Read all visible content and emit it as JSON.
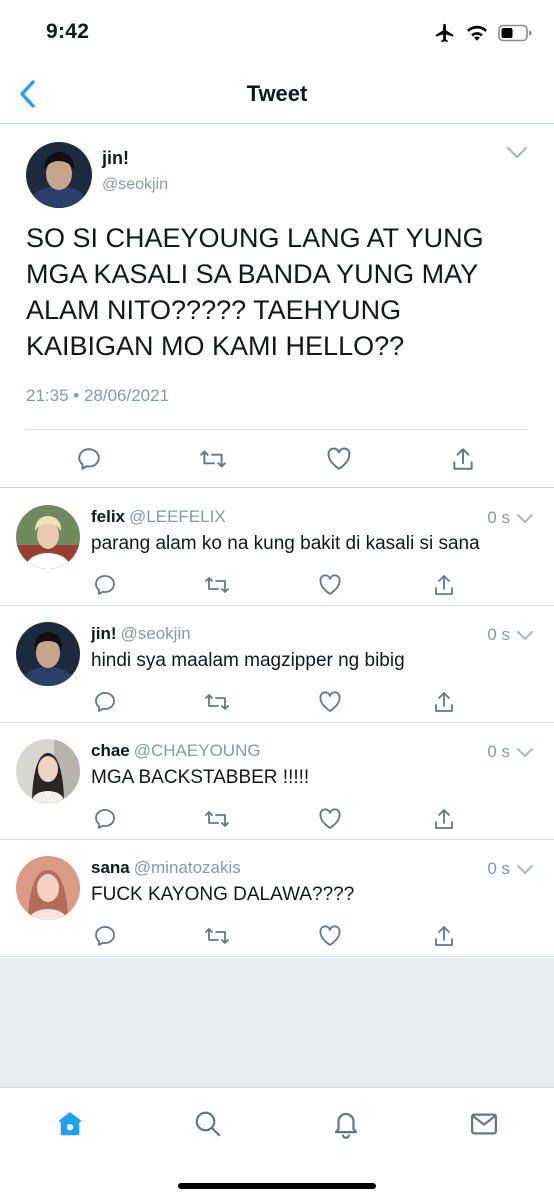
{
  "status_bar": {
    "time": "9:42"
  },
  "nav": {
    "title": "Tweet"
  },
  "main_tweet": {
    "name": "jin!",
    "handle": "@seokjin",
    "text": "SO SI CHAEYOUNG LANG AT YUNG MGA KASALI SA BANDA YUNG MAY ALAM NITO????? TAEHYUNG KAIBIGAN MO KAMI HELLO??",
    "timestamp": "21:35 • 28/06/2021"
  },
  "replies": [
    {
      "name": "felix",
      "handle": "@LEEFELIX",
      "time": "0 s",
      "text": "parang alam ko na kung bakit di kasali si sana"
    },
    {
      "name": "jin!",
      "handle": "@seokjin",
      "time": "0 s",
      "text": "hindi sya maalam magzipper ng bibig"
    },
    {
      "name": "chae",
      "handle": "@CHAEYOUNG",
      "time": "0 s",
      "text": "MGA BACKSTABBER !!!!!"
    },
    {
      "name": "sana",
      "handle": "@minatozakis",
      "time": "0 s",
      "text": "FUCK KAYONG DALAWA????"
    }
  ],
  "action_icons": [
    "reply-icon",
    "retweet-icon",
    "like-icon",
    "share-icon"
  ],
  "tabs": [
    "home-icon",
    "search-icon",
    "notifications-icon",
    "messages-icon"
  ],
  "colors": {
    "accent": "#1da1f2",
    "secondary_text": "#8899a6",
    "icon_gray": "#657786",
    "background_empty": "#e6ecf0"
  }
}
